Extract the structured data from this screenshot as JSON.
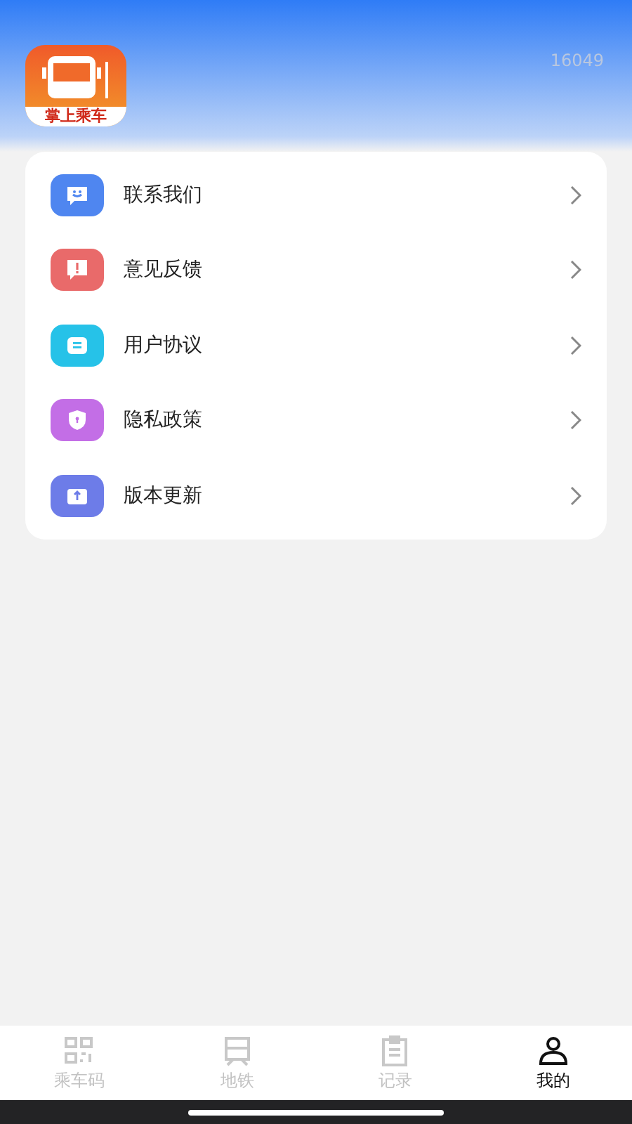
{
  "header": {
    "logo_text": "掌上乘车",
    "user_id": "16049"
  },
  "menu": [
    {
      "label": "联系我们",
      "kind": "chat",
      "color": "#4f86f0"
    },
    {
      "label": "意见反馈",
      "kind": "alert",
      "color": "#e96a6a"
    },
    {
      "label": "用户协议",
      "kind": "document",
      "color": "#26c2e8"
    },
    {
      "label": "隐私政策",
      "kind": "shield",
      "color": "#c36ee6"
    },
    {
      "label": "版本更新",
      "kind": "box",
      "color": "#6d7ce8"
    }
  ],
  "tabs": [
    {
      "label": "乘车码",
      "kind": "qr",
      "selected": false
    },
    {
      "label": "地铁",
      "kind": "metro",
      "selected": false
    },
    {
      "label": "记录",
      "kind": "clipboard",
      "selected": false
    },
    {
      "label": "我的",
      "kind": "person",
      "selected": true
    }
  ]
}
